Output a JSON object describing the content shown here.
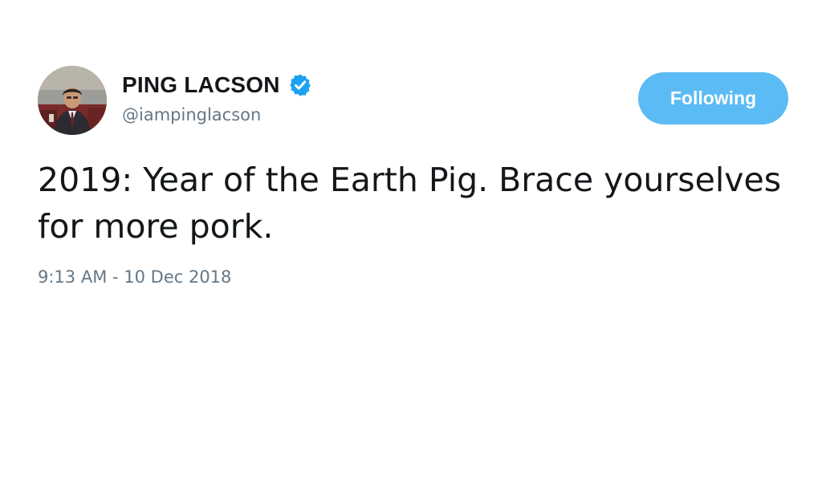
{
  "tweet": {
    "author": {
      "display_name": "PING LACSON",
      "handle": "@iampinglacson",
      "verified": true,
      "avatar": "profile-photo"
    },
    "follow_button_label": "Following",
    "text_lines": [
      "2019: Year of the Earth Pig. Brace yourselves",
      "for more pork."
    ],
    "timestamp": "9:13 AM - 10 Dec 2018"
  },
  "colors": {
    "accent": "#1da1f2",
    "text_primary": "#14171a",
    "text_secondary": "#657786",
    "background": "#ffffff"
  },
  "icons": {
    "verified": "verified-badge-icon"
  }
}
